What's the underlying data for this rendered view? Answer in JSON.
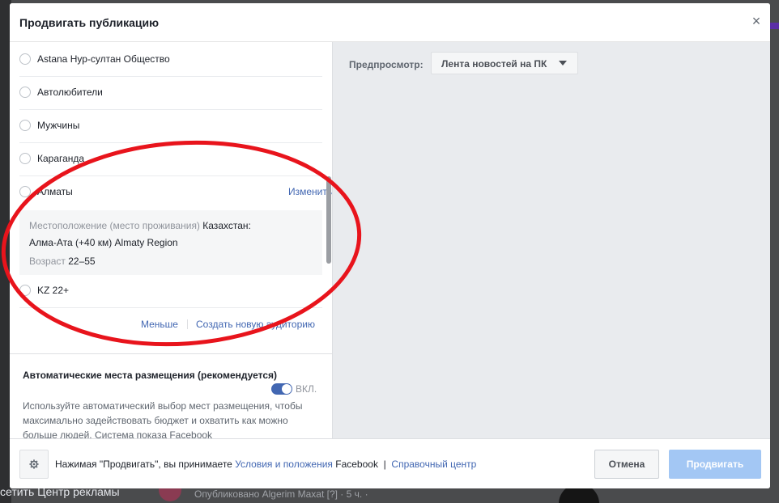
{
  "background": {
    "footer_text": "сетить Центр рекламы",
    "post_text": "Опубликовано Algerim Maxat [?] · 5 ч. ·"
  },
  "modal": {
    "title": "Продвигать публикацию",
    "close_glyph": "×"
  },
  "audiences": {
    "items": [
      {
        "label": "Astana Нур-султан Общество"
      },
      {
        "label": "Автолюбители"
      },
      {
        "label": "Мужчины"
      },
      {
        "label": "Караганда"
      },
      {
        "label": "Алматы",
        "edit": "Изменить"
      },
      {
        "label": "KZ 22+"
      }
    ],
    "selected_detail": {
      "location_label": "Местоположение (место проживания)",
      "location_value_1": "Казахстан:",
      "location_value_2": "Алма-Ата (+40 км) Almaty Region",
      "age_label": "Возраст",
      "age_value": "22–55"
    },
    "less_link": "Меньше",
    "create_link": "Создать новую аудиторию"
  },
  "placements": {
    "title": "Автоматические места размещения (рекомендуется)",
    "toggle_label": "ВКЛ.",
    "toggle_on": true,
    "description": "Используйте автоматический выбор мест размещения, чтобы максимально задействовать бюджет и охватить как можно больше людей. Система показа Facebook"
  },
  "preview": {
    "label": "Предпросмотр:",
    "selected": "Лента новостей на ПК"
  },
  "footer": {
    "text_prefix": "Нажимая \"Продвигать\", вы принимаете",
    "terms_link": "Условия и положения",
    "text_brand": "Facebook",
    "separator": "|",
    "help_link": "Справочный центр",
    "cancel_label": "Отмена",
    "promote_label": "Продвигать"
  },
  "colors": {
    "accent": "#4267b2",
    "annotation": "#e8141c",
    "promote_disabled": "#a3c7f4"
  },
  "icons": {
    "settings": "gear-icon",
    "close": "close-icon",
    "caret": "caret-down-icon"
  }
}
